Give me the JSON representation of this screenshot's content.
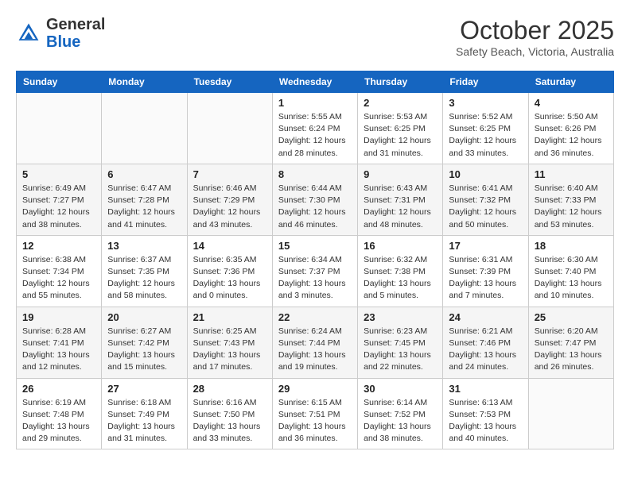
{
  "header": {
    "logo_general": "General",
    "logo_blue": "Blue",
    "month": "October 2025",
    "location": "Safety Beach, Victoria, Australia"
  },
  "weekdays": [
    "Sunday",
    "Monday",
    "Tuesday",
    "Wednesday",
    "Thursday",
    "Friday",
    "Saturday"
  ],
  "weeks": [
    [
      {
        "day": "",
        "info": ""
      },
      {
        "day": "",
        "info": ""
      },
      {
        "day": "",
        "info": ""
      },
      {
        "day": "1",
        "info": "Sunrise: 5:55 AM\nSunset: 6:24 PM\nDaylight: 12 hours and 28 minutes."
      },
      {
        "day": "2",
        "info": "Sunrise: 5:53 AM\nSunset: 6:25 PM\nDaylight: 12 hours and 31 minutes."
      },
      {
        "day": "3",
        "info": "Sunrise: 5:52 AM\nSunset: 6:25 PM\nDaylight: 12 hours and 33 minutes."
      },
      {
        "day": "4",
        "info": "Sunrise: 5:50 AM\nSunset: 6:26 PM\nDaylight: 12 hours and 36 minutes."
      }
    ],
    [
      {
        "day": "5",
        "info": "Sunrise: 6:49 AM\nSunset: 7:27 PM\nDaylight: 12 hours and 38 minutes."
      },
      {
        "day": "6",
        "info": "Sunrise: 6:47 AM\nSunset: 7:28 PM\nDaylight: 12 hours and 41 minutes."
      },
      {
        "day": "7",
        "info": "Sunrise: 6:46 AM\nSunset: 7:29 PM\nDaylight: 12 hours and 43 minutes."
      },
      {
        "day": "8",
        "info": "Sunrise: 6:44 AM\nSunset: 7:30 PM\nDaylight: 12 hours and 46 minutes."
      },
      {
        "day": "9",
        "info": "Sunrise: 6:43 AM\nSunset: 7:31 PM\nDaylight: 12 hours and 48 minutes."
      },
      {
        "day": "10",
        "info": "Sunrise: 6:41 AM\nSunset: 7:32 PM\nDaylight: 12 hours and 50 minutes."
      },
      {
        "day": "11",
        "info": "Sunrise: 6:40 AM\nSunset: 7:33 PM\nDaylight: 12 hours and 53 minutes."
      }
    ],
    [
      {
        "day": "12",
        "info": "Sunrise: 6:38 AM\nSunset: 7:34 PM\nDaylight: 12 hours and 55 minutes."
      },
      {
        "day": "13",
        "info": "Sunrise: 6:37 AM\nSunset: 7:35 PM\nDaylight: 12 hours and 58 minutes."
      },
      {
        "day": "14",
        "info": "Sunrise: 6:35 AM\nSunset: 7:36 PM\nDaylight: 13 hours and 0 minutes."
      },
      {
        "day": "15",
        "info": "Sunrise: 6:34 AM\nSunset: 7:37 PM\nDaylight: 13 hours and 3 minutes."
      },
      {
        "day": "16",
        "info": "Sunrise: 6:32 AM\nSunset: 7:38 PM\nDaylight: 13 hours and 5 minutes."
      },
      {
        "day": "17",
        "info": "Sunrise: 6:31 AM\nSunset: 7:39 PM\nDaylight: 13 hours and 7 minutes."
      },
      {
        "day": "18",
        "info": "Sunrise: 6:30 AM\nSunset: 7:40 PM\nDaylight: 13 hours and 10 minutes."
      }
    ],
    [
      {
        "day": "19",
        "info": "Sunrise: 6:28 AM\nSunset: 7:41 PM\nDaylight: 13 hours and 12 minutes."
      },
      {
        "day": "20",
        "info": "Sunrise: 6:27 AM\nSunset: 7:42 PM\nDaylight: 13 hours and 15 minutes."
      },
      {
        "day": "21",
        "info": "Sunrise: 6:25 AM\nSunset: 7:43 PM\nDaylight: 13 hours and 17 minutes."
      },
      {
        "day": "22",
        "info": "Sunrise: 6:24 AM\nSunset: 7:44 PM\nDaylight: 13 hours and 19 minutes."
      },
      {
        "day": "23",
        "info": "Sunrise: 6:23 AM\nSunset: 7:45 PM\nDaylight: 13 hours and 22 minutes."
      },
      {
        "day": "24",
        "info": "Sunrise: 6:21 AM\nSunset: 7:46 PM\nDaylight: 13 hours and 24 minutes."
      },
      {
        "day": "25",
        "info": "Sunrise: 6:20 AM\nSunset: 7:47 PM\nDaylight: 13 hours and 26 minutes."
      }
    ],
    [
      {
        "day": "26",
        "info": "Sunrise: 6:19 AM\nSunset: 7:48 PM\nDaylight: 13 hours and 29 minutes."
      },
      {
        "day": "27",
        "info": "Sunrise: 6:18 AM\nSunset: 7:49 PM\nDaylight: 13 hours and 31 minutes."
      },
      {
        "day": "28",
        "info": "Sunrise: 6:16 AM\nSunset: 7:50 PM\nDaylight: 13 hours and 33 minutes."
      },
      {
        "day": "29",
        "info": "Sunrise: 6:15 AM\nSunset: 7:51 PM\nDaylight: 13 hours and 36 minutes."
      },
      {
        "day": "30",
        "info": "Sunrise: 6:14 AM\nSunset: 7:52 PM\nDaylight: 13 hours and 38 minutes."
      },
      {
        "day": "31",
        "info": "Sunrise: 6:13 AM\nSunset: 7:53 PM\nDaylight: 13 hours and 40 minutes."
      },
      {
        "day": "",
        "info": ""
      }
    ]
  ]
}
